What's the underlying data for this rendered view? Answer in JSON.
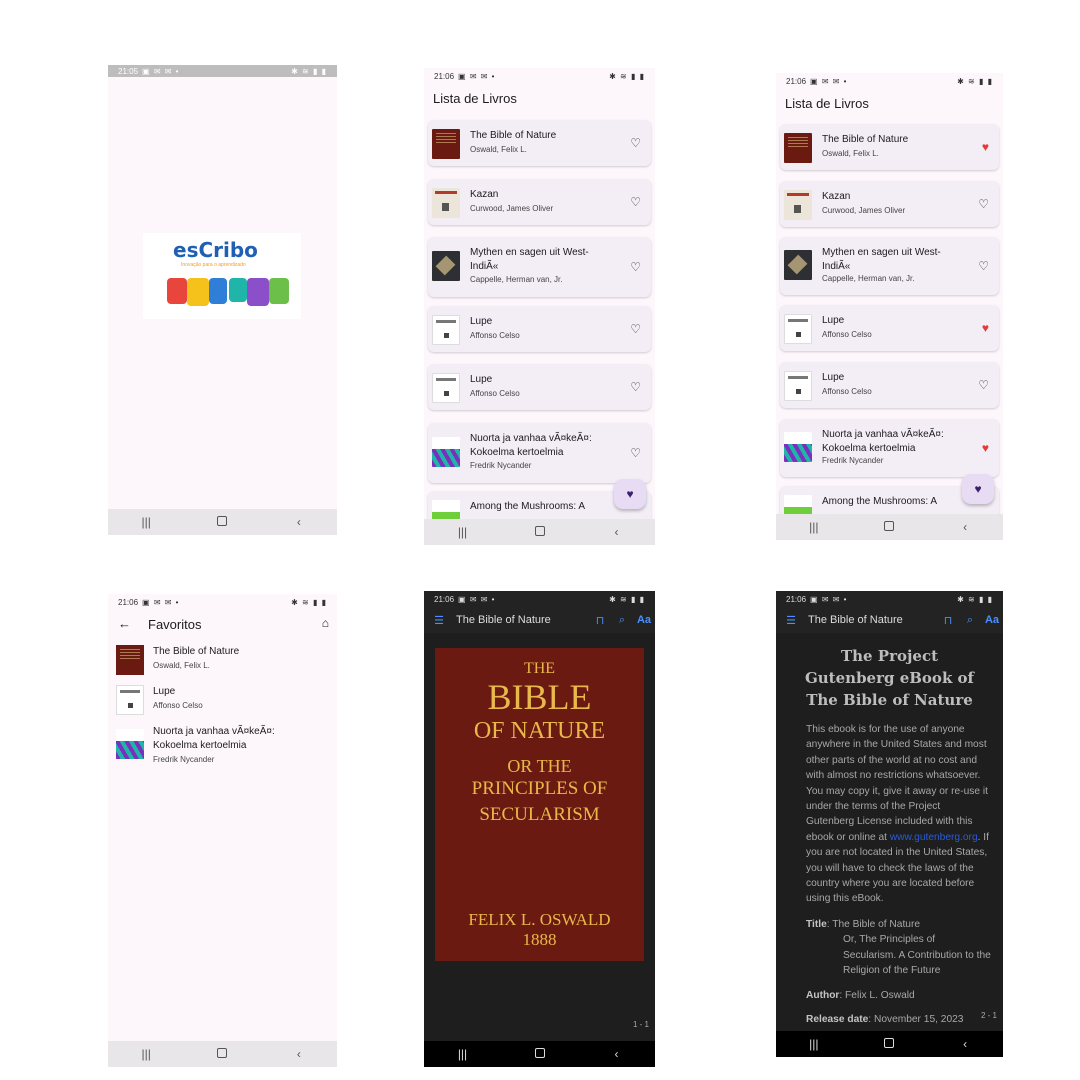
{
  "status": {
    "time_splash": "21:05",
    "time": "21:06",
    "left_icons": "▣ ✉ ✉ •",
    "right_icons": "✱ ≋ ▮ ▮"
  },
  "splash": {
    "logo_text": "esCribo",
    "tagline": "Inovação para o aprendizado"
  },
  "list": {
    "title": "Lista de Livros",
    "books": [
      {
        "title": "The Bible of Nature",
        "author": "Oswald, Felix L."
      },
      {
        "title": "Kazan",
        "author": "Curwood, James Oliver"
      },
      {
        "title": "Mythen en sagen uit West-IndiÃ«",
        "author": "Cappelle, Herman van, Jr."
      },
      {
        "title": "Lupe",
        "author": "Affonso Celso"
      },
      {
        "title": "Lupe",
        "author": "Affonso Celso"
      },
      {
        "title": "Nuorta ja vanhaa vÃ¤keÃ¤: Kokoelma kertoelmia",
        "author": "Fredrik Nycander"
      },
      {
        "title": "Among the Mushrooms: A",
        "author": ""
      }
    ],
    "favorited_states_screen3": [
      true,
      false,
      false,
      true,
      false,
      true
    ]
  },
  "favorites": {
    "title": "Favoritos",
    "books": [
      {
        "title": "The Bible of Nature",
        "author": "Oswald, Felix L."
      },
      {
        "title": "Lupe",
        "author": "Affonso Celso"
      },
      {
        "title": "Nuorta ja vanhaa vÃ¤keÃ¤: Kokoelma kertoelmia",
        "author": "Fredrik Nycander"
      }
    ]
  },
  "reader": {
    "title": "The Bible of Nature",
    "cover": {
      "line1": "THE",
      "line2": "BIBLE",
      "line3": "OF NATURE",
      "line4": "OR THE",
      "line5": "PRINCIPLES OF",
      "line6": "SECULARISM",
      "author": "FELIX L. OSWALD",
      "year": "1888"
    },
    "page1": "1 - 1",
    "page2": "2 - 1",
    "heading": "The Project Gutenberg eBook of The Bible of Nature",
    "body_before_link": "This ebook is for the use of anyone anywhere in the United States and most other parts of the world at no cost and with almost no restrictions whatsoever. You may copy it, give it away or re-use it under the terms of the Project Gutenberg License included with this ebook or online at ",
    "link": "www.gutenberg.org",
    "body_after_link": ". If you are not located in the United States, you will have to check the laws of the country where you are located before using this eBook.",
    "title_label": "Title",
    "title_value": ": The Bible of Nature",
    "title_cont": "Or, The Principles of Secularism. A Contribution to the Religion of the Future",
    "author_label": "Author",
    "author_value": ": Felix L. Oswald",
    "release_label": "Release date",
    "release_value": ": November 15, 2023"
  },
  "colors": {
    "heart_fav": "#e53935",
    "reader_bg": "#1e1e1e",
    "cover_bg": "#6b1a12",
    "cover_text": "#e8b84a",
    "link": "#2a5bd7"
  }
}
